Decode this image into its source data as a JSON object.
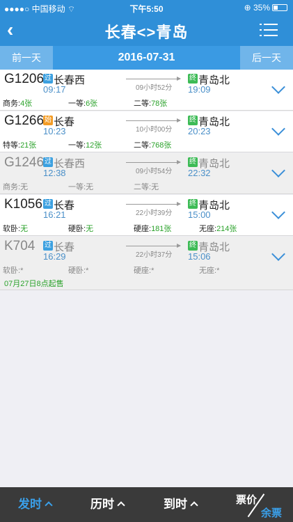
{
  "status": {
    "carrier": "●●●●○ 中国移动 ",
    "wifi_icon": "wifi-icon",
    "time": "下午5:50",
    "battery": "35%"
  },
  "nav": {
    "title": "长春<>青岛"
  },
  "datebar": {
    "prev_label": "前一天",
    "date": "2016-07-31",
    "next_label": "后一天"
  },
  "trains": [
    {
      "code": "G1206",
      "from_tag": "过",
      "from": "长春西",
      "dep": "09:17",
      "duration": "09小时52分",
      "to_tag": "终",
      "to": "青岛北",
      "arr": "19:09",
      "s1_label": "商务:",
      "s1_val": "4张",
      "s2_label": "一等:",
      "s2_val": "6张",
      "s3_label": "二等:",
      "s3_val": "78张",
      "s4_label": "",
      "s4_val": ""
    },
    {
      "code": "G1266",
      "from_tag": "始",
      "from": "长春",
      "dep": "10:23",
      "duration": "10小时00分",
      "to_tag": "终",
      "to": "青岛北",
      "arr": "20:23",
      "s1_label": "特等:",
      "s1_val": "21张",
      "s2_label": "一等:",
      "s2_val": "12张",
      "s3_label": "二等:",
      "s3_val": "768张",
      "s4_label": "",
      "s4_val": ""
    },
    {
      "code": "G1246",
      "from_tag": "过",
      "from": "长春西",
      "dep": "12:38",
      "duration": "09小时54分",
      "to_tag": "终",
      "to": "青岛北",
      "arr": "22:32",
      "s1_label": "商务:",
      "s1_val": "无",
      "s2_label": "一等:",
      "s2_val": "无",
      "s3_label": "二等:",
      "s3_val": "无",
      "s4_label": "",
      "s4_val": ""
    },
    {
      "code": "K1056",
      "from_tag": "过",
      "from": "长春",
      "dep": "16:21",
      "duration": "22小时39分",
      "to_tag": "终",
      "to": "青岛北",
      "arr": "15:00",
      "s1_label": "软卧:",
      "s1_val": "无",
      "s2_label": "硬卧:",
      "s2_val": "无",
      "s3_label": "硬座:",
      "s3_val": "181张",
      "s4_label": "无座:",
      "s4_val": "214张"
    },
    {
      "code": "K704",
      "from_tag": "过",
      "from": "长春",
      "dep": "16:29",
      "duration": "22小时37分",
      "to_tag": "终",
      "to": "青岛北",
      "arr": "15:06",
      "s1_label": "软卧:",
      "s1_val": "*",
      "s2_label": "硬卧:",
      "s2_val": "*",
      "s3_label": "硬座:",
      "s3_val": "*",
      "s4_label": "无座:",
      "s4_val": "*",
      "note": "07月27日8点起售"
    }
  ],
  "bottom": {
    "depart_label": "发时",
    "duration_label": "历时",
    "arrive_label": "到时",
    "price_label": "票价",
    "remain_label": "余票"
  },
  "colors": {
    "primary": "#2f8fd8",
    "available": "#2aa22a",
    "time_blue": "#4a8fc8"
  }
}
